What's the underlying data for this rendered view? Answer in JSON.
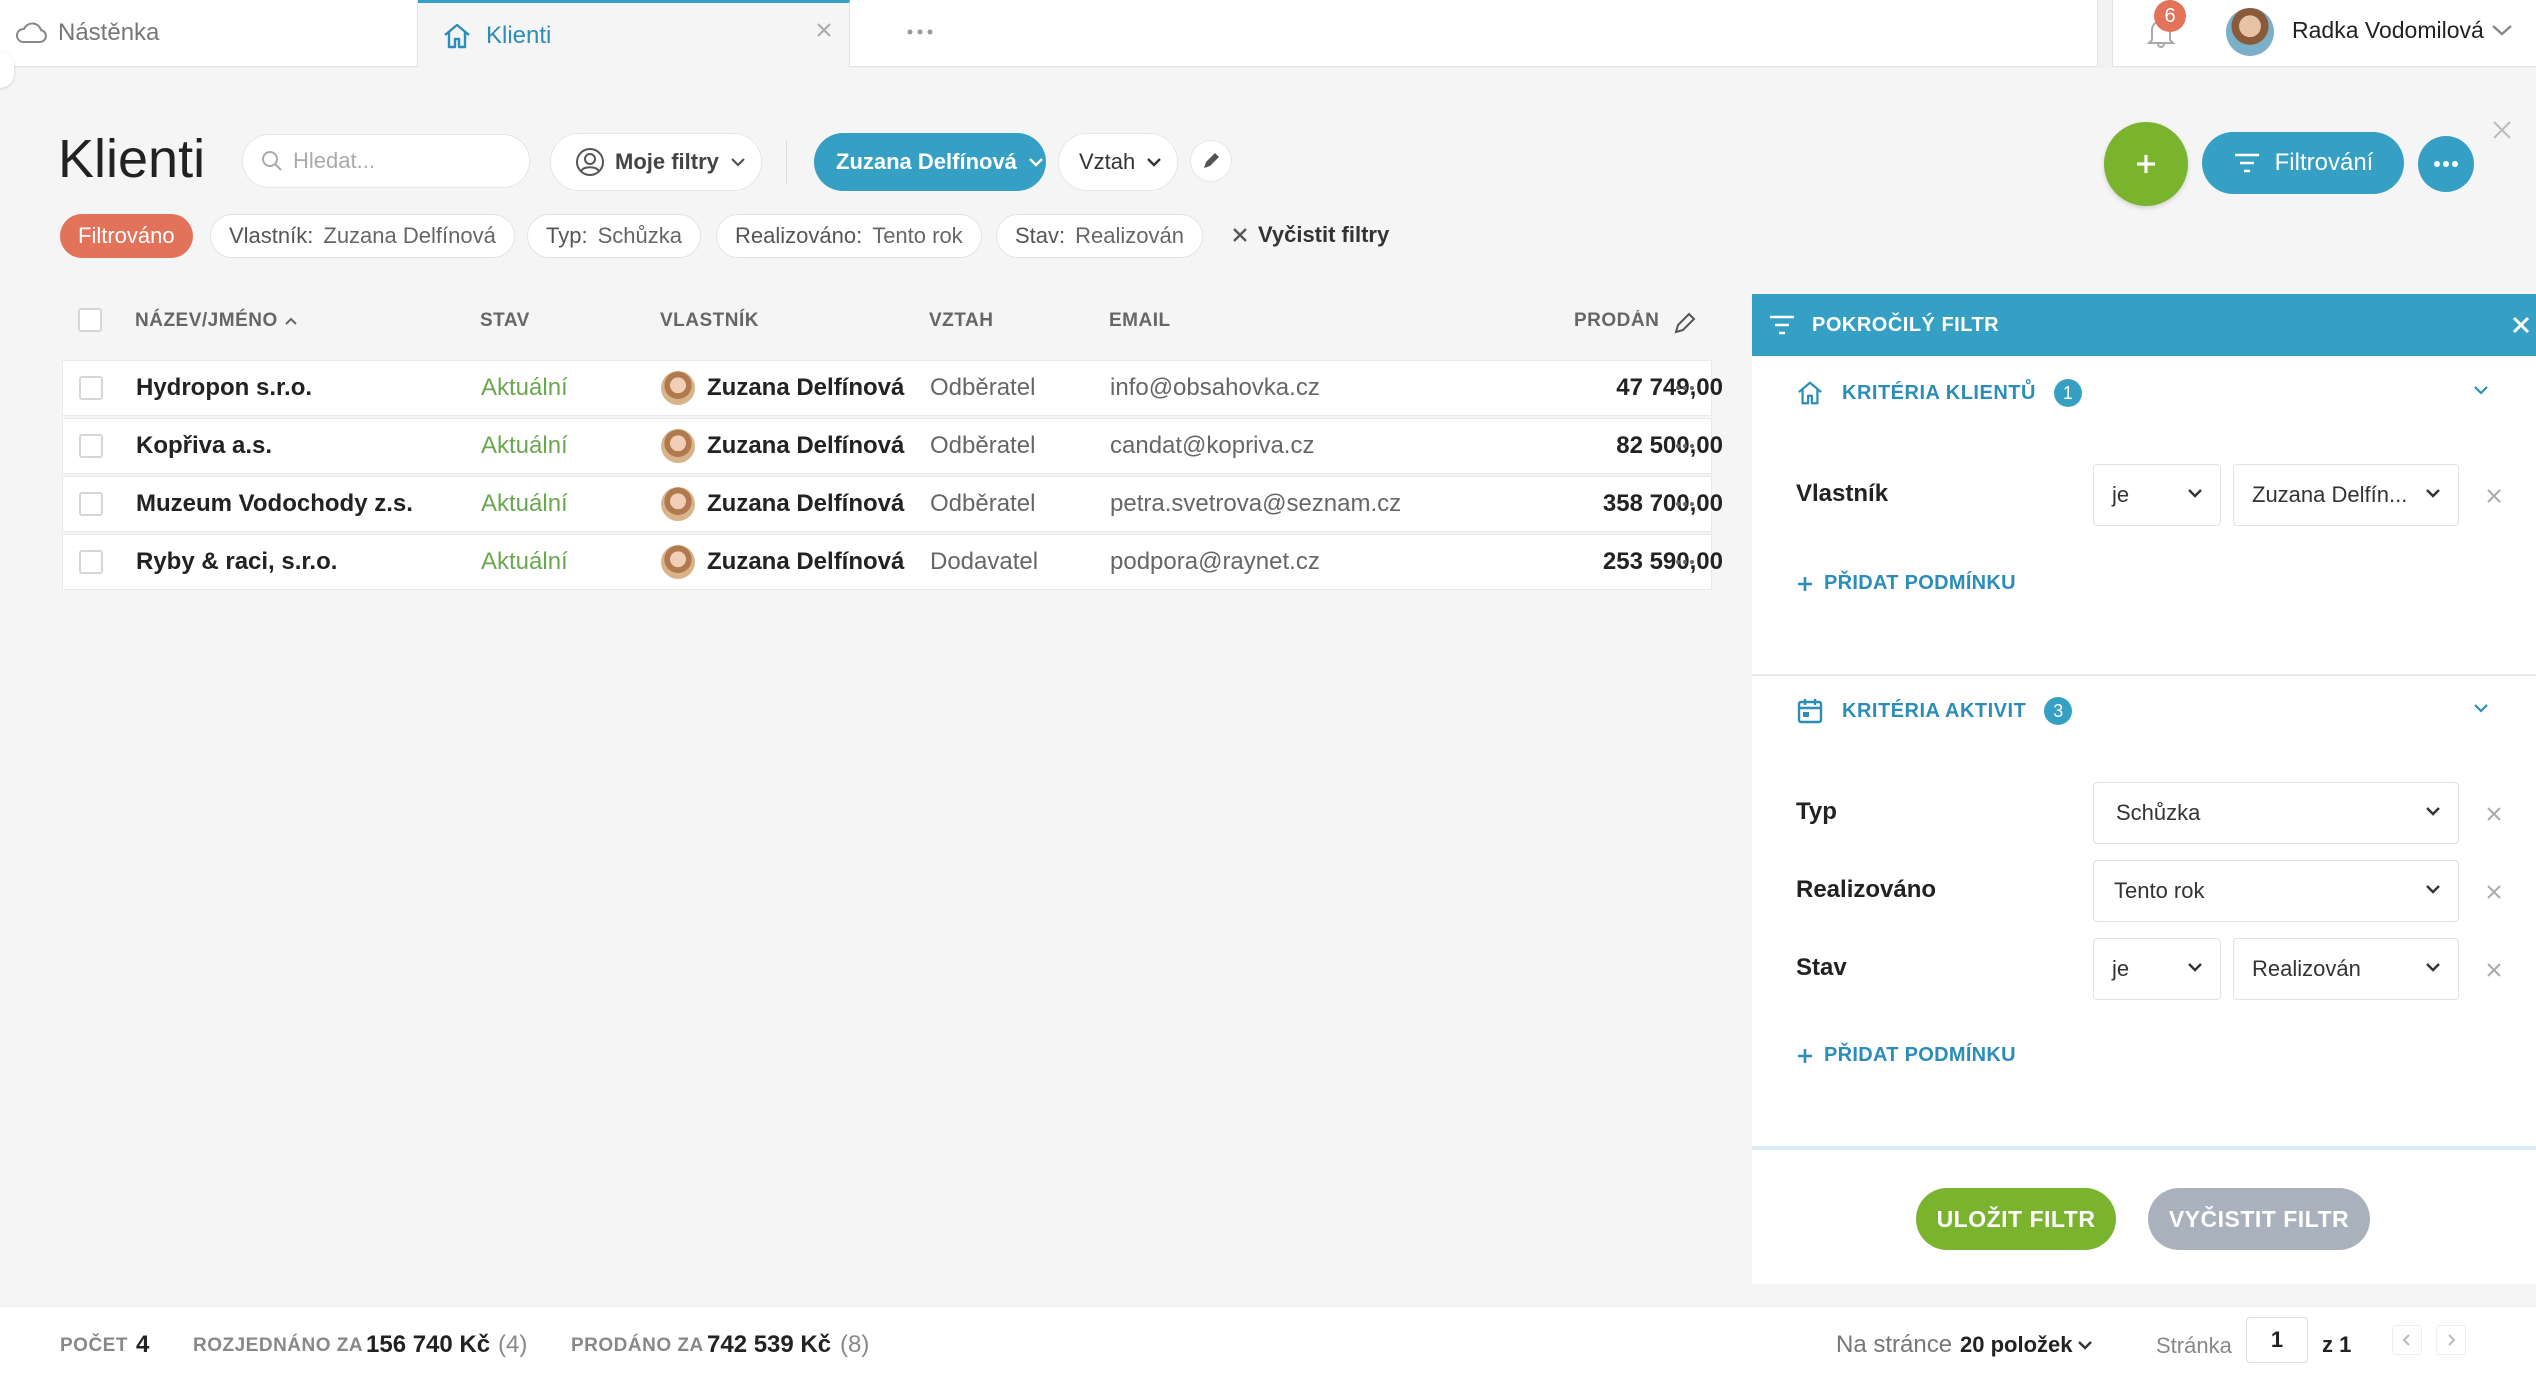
{
  "tabs": {
    "dashboard_label": "Nástěnka",
    "active_label": "Klienti"
  },
  "user": {
    "name": "Radka Vodomilová",
    "notifications": "6"
  },
  "header": {
    "title": "Klienti",
    "search_placeholder": "Hledat...",
    "my_filters": "Moje filtry",
    "owner_filter": "Zuzana Delfínová",
    "relation_filter": "Vztah",
    "filter_button": "Filtrování"
  },
  "chips": {
    "filtered": "Filtrováno",
    "owner_key": "Vlastník:",
    "owner_val": "Zuzana Delfínová",
    "type_key": "Typ:",
    "type_val": "Schůzka",
    "done_key": "Realizováno:",
    "done_val": "Tento rok",
    "state_key": "Stav:",
    "state_val": "Realizován",
    "clear": "Vyčistit filtry"
  },
  "table": {
    "columns": [
      "NÁZEV/JMÉNO",
      "STAV",
      "VLASTNÍK",
      "VZTAH",
      "EMAIL",
      "PRODÁNO"
    ],
    "rows": [
      {
        "name": "Hydropon s.r.o.",
        "state": "Aktuální",
        "owner": "Zuzana Delfínová",
        "relation": "Odběratel",
        "email": "info@obsahovka.cz",
        "sold": "47 749,00"
      },
      {
        "name": "Kopřiva a.s.",
        "state": "Aktuální",
        "owner": "Zuzana Delfínová",
        "relation": "Odběratel",
        "email": "candat@kopriva.cz",
        "sold": "82 500,00"
      },
      {
        "name": "Muzeum Vodochody z.s.",
        "state": "Aktuální",
        "owner": "Zuzana Delfínová",
        "relation": "Odběratel",
        "email": "petra.svetrova@seznam.cz",
        "sold": "358 700,00"
      },
      {
        "name": "Ryby & raci, s.r.o.",
        "state": "Aktuální",
        "owner": "Zuzana Delfínová",
        "relation": "Dodavatel",
        "email": "podpora@raynet.cz",
        "sold": "253 590,00"
      }
    ]
  },
  "panel": {
    "title": "POKROČILÝ FILTR",
    "client_section": "KRITÉRIA KLIENTŮ",
    "client_count": "1",
    "owner_label": "Vlastník",
    "owner_op": "je",
    "owner_value": "Zuzana Delfín...",
    "add_condition": "PŘIDAT PODMÍNKU",
    "activity_section": "KRITÉRIA AKTIVIT",
    "activity_count": "3",
    "type_label": "Typ",
    "type_value": "Schůzka",
    "done_label": "Realizováno",
    "done_value": "Tento rok",
    "state_label": "Stav",
    "state_op": "je",
    "state_value": "Realizován",
    "save": "ULOŽIT FILTR",
    "clear": "VYČISTIT FILTR"
  },
  "footer": {
    "count_label": "POČET",
    "count": "4",
    "negotiated_label": "ROZJEDNÁNO ZA",
    "negotiated_val": "156 740 Kč",
    "negotiated_cnt": "(4)",
    "sold_label": "PRODÁNO ZA",
    "sold_val": "742 539 Kč",
    "sold_cnt": "(8)",
    "per_page_label": "Na stránce",
    "per_page_val": "20 položek",
    "page_label": "Stránka",
    "page": "1",
    "of": "z 1"
  },
  "colors": {
    "accent": "#36a0c4",
    "green": "#7ab32e",
    "red": "#e2735a",
    "status_green": "#6aa84f"
  }
}
